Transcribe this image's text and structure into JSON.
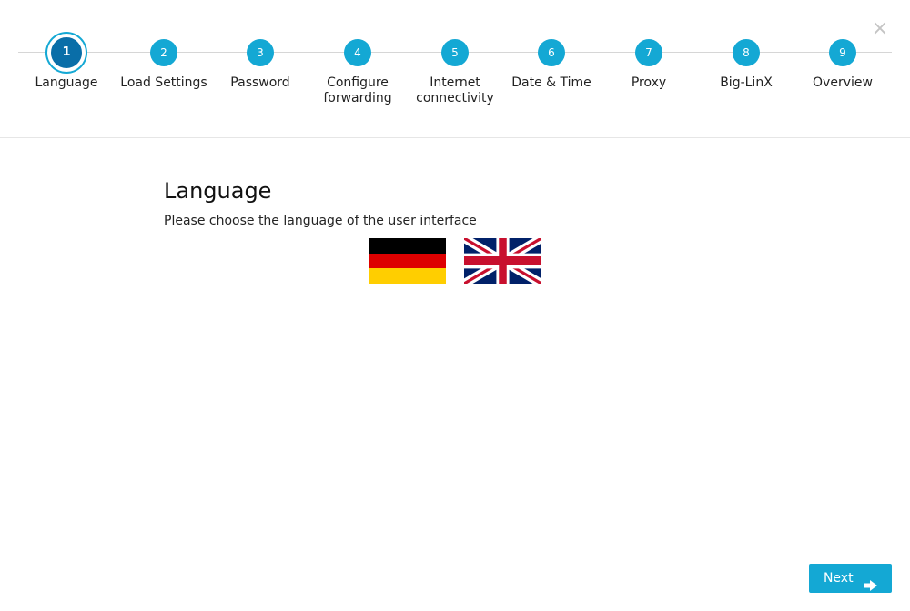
{
  "wizard": {
    "close_symbol": "×",
    "steps": [
      {
        "number": "1",
        "label": "Language"
      },
      {
        "number": "2",
        "label": "Load Settings"
      },
      {
        "number": "3",
        "label": "Password"
      },
      {
        "number": "4",
        "label": "Configure forwarding"
      },
      {
        "number": "5",
        "label": "Internet connectivity"
      },
      {
        "number": "6",
        "label": "Date & Time"
      },
      {
        "number": "7",
        "label": "Proxy"
      },
      {
        "number": "8",
        "label": "Big-LinX"
      },
      {
        "number": "9",
        "label": "Overview"
      }
    ],
    "active_step": 1
  },
  "content": {
    "title": "Language",
    "description": "Please choose the language of the user interface",
    "flags": [
      {
        "icon": "german-flag-icon"
      },
      {
        "icon": "uk-flag-icon"
      }
    ]
  },
  "footer": {
    "next_label": "Next",
    "next_icon": "arrow-right-icon"
  },
  "colors": {
    "accent": "#14a8d4",
    "active_step": "#0a6ea8",
    "close_icon": "#c4c4c4"
  }
}
